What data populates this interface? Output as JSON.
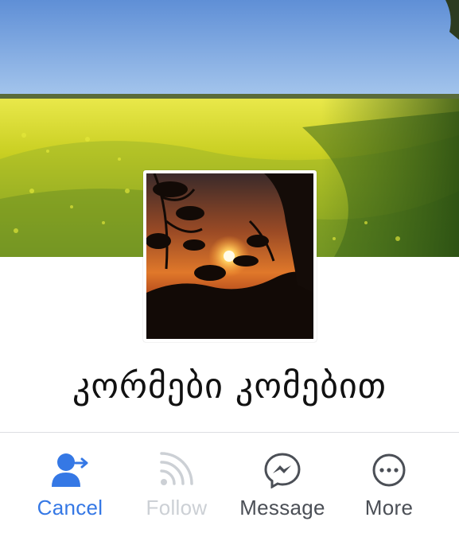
{
  "profile": {
    "name": "კორმები კომებით",
    "cover_photo": "rapeseed field under blue sky",
    "profile_photo": "sunset behind trees"
  },
  "actions": [
    {
      "label": "Cancel",
      "icon": "person-arrow-icon",
      "state": "active",
      "color": "#3578e5"
    },
    {
      "label": "Follow",
      "icon": "rss-icon",
      "state": "disabled",
      "color": "#ccd0d5"
    },
    {
      "label": "Message",
      "icon": "messenger-icon",
      "state": "normal",
      "color": "#4b4f56"
    },
    {
      "label": "More",
      "icon": "more-dots-icon",
      "state": "normal",
      "color": "#4b4f56"
    }
  ]
}
